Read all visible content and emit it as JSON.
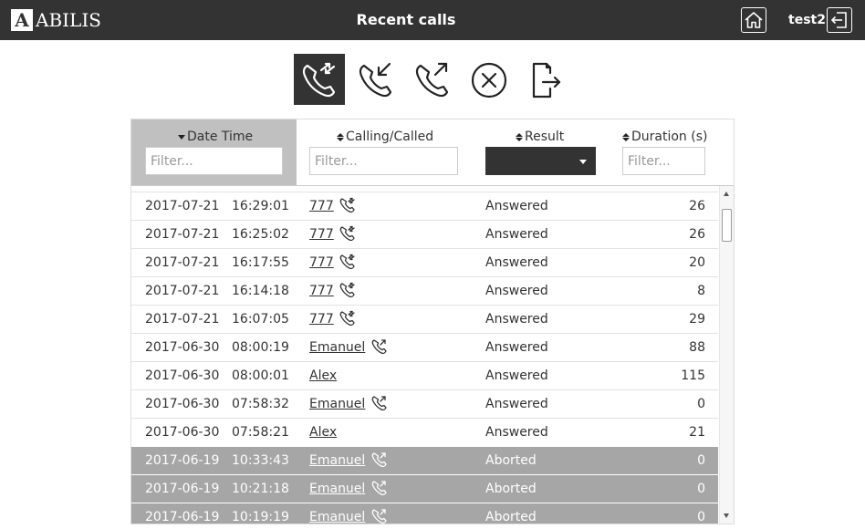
{
  "header": {
    "logo_letter": "A",
    "logo_text": "ABILIS",
    "title": "Recent calls",
    "user": "test2",
    "home_icon": "home-icon",
    "logout_icon": "logout-icon"
  },
  "toolbar": {
    "tools": [
      {
        "icon": "all-calls-icon",
        "active": true
      },
      {
        "icon": "incoming-calls-icon",
        "active": false
      },
      {
        "icon": "outgoing-calls-icon",
        "active": false
      },
      {
        "icon": "delete-icon",
        "active": false
      },
      {
        "icon": "export-icon",
        "active": false
      }
    ]
  },
  "table": {
    "columns": [
      {
        "label": "Date Time",
        "sort": "desc",
        "filter_placeholder": "Filter..."
      },
      {
        "label": "Calling/Called",
        "sort": "both",
        "filter_placeholder": "Filter..."
      },
      {
        "label": "Result",
        "sort": "both",
        "filter_value": ""
      },
      {
        "label": "Duration (s)",
        "sort": "both",
        "filter_placeholder": "Filter..."
      }
    ],
    "rows": [
      {
        "date": "2017-07-21",
        "time": "16:29:01",
        "party": "777",
        "icon": "call-bidirectional-icon",
        "result": "Answered",
        "duration": "26",
        "status": "answered"
      },
      {
        "date": "2017-07-21",
        "time": "16:25:02",
        "party": "777",
        "icon": "call-bidirectional-icon",
        "result": "Answered",
        "duration": "26",
        "status": "answered"
      },
      {
        "date": "2017-07-21",
        "time": "16:17:55",
        "party": "777",
        "icon": "call-bidirectional-icon",
        "result": "Answered",
        "duration": "20",
        "status": "answered"
      },
      {
        "date": "2017-07-21",
        "time": "16:14:18",
        "party": "777",
        "icon": "call-bidirectional-icon",
        "result": "Answered",
        "duration": "8",
        "status": "answered"
      },
      {
        "date": "2017-07-21",
        "time": "16:07:05",
        "party": "777",
        "icon": "call-bidirectional-icon",
        "result": "Answered",
        "duration": "29",
        "status": "answered"
      },
      {
        "date": "2017-06-30",
        "time": "08:00:19",
        "party": "Emanuel",
        "icon": "call-outgoing-icon",
        "result": "Answered",
        "duration": "88",
        "status": "answered"
      },
      {
        "date": "2017-06-30",
        "time": "08:00:01",
        "party": "Alex",
        "icon": "",
        "result": "Answered",
        "duration": "115",
        "status": "answered"
      },
      {
        "date": "2017-06-30",
        "time": "07:58:32",
        "party": "Emanuel",
        "icon": "call-outgoing-icon",
        "result": "Answered",
        "duration": "0",
        "status": "answered"
      },
      {
        "date": "2017-06-30",
        "time": "07:58:21",
        "party": "Alex",
        "icon": "",
        "result": "Answered",
        "duration": "21",
        "status": "answered"
      },
      {
        "date": "2017-06-19",
        "time": "10:33:43",
        "party": "Emanuel",
        "icon": "call-outgoing-icon",
        "result": "Aborted",
        "duration": "0",
        "status": "aborted"
      },
      {
        "date": "2017-06-19",
        "time": "10:21:18",
        "party": "Emanuel",
        "icon": "call-outgoing-icon",
        "result": "Aborted",
        "duration": "0",
        "status": "aborted"
      },
      {
        "date": "2017-06-19",
        "time": "10:19:19",
        "party": "Emanuel",
        "icon": "call-outgoing-icon",
        "result": "Aborted",
        "duration": "0",
        "status": "aborted"
      }
    ]
  },
  "colors": {
    "topbar": "#333333",
    "active_tool": "#333333",
    "sorted_header": "#c0c0c0",
    "aborted_row": "#a6a6a6"
  }
}
